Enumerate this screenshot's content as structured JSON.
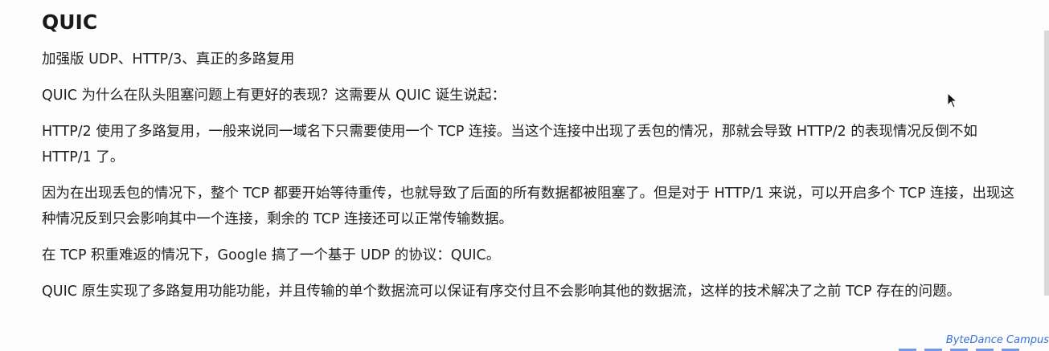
{
  "title": "QUIC",
  "paragraphs": [
    "加强版 UDP、HTTP/3、真正的多路复用",
    "QUIC 为什么在队头阻塞问题上有更好的表现？这需要从 QUIC 诞生说起：",
    "HTTP/2 使用了多路复用，一般来说同一域名下只需要使用一个 TCP 连接。当这个连接中出现了丢包的情况，那就会导致 HTTP/2 的表现情况反倒不如 HTTP/1 了。",
    "因为在出现丢包的情况下，整个 TCP 都要开始等待重传，也就导致了后面的所有数据都被阻塞了。但是对于 HTTP/1 来说，可以开启多个 TCP 连接，出现这种情况反到只会影响其中一个连接，剩余的 TCP 连接还可以正常传输数据。",
    "在 TCP 积重难返的情况下，Google 搞了一个基于 UDP 的协议：QUIC。",
    "QUIC 原生实现了多路复用功能功能，并且传输的单个数据流可以保证有序交付且不会影响其他的数据流，这样的技术解决了之前 TCP 存在的问题。"
  ],
  "branding": "ByteDance Campus",
  "icons": {
    "cursor": "mouse-pointer-icon"
  }
}
